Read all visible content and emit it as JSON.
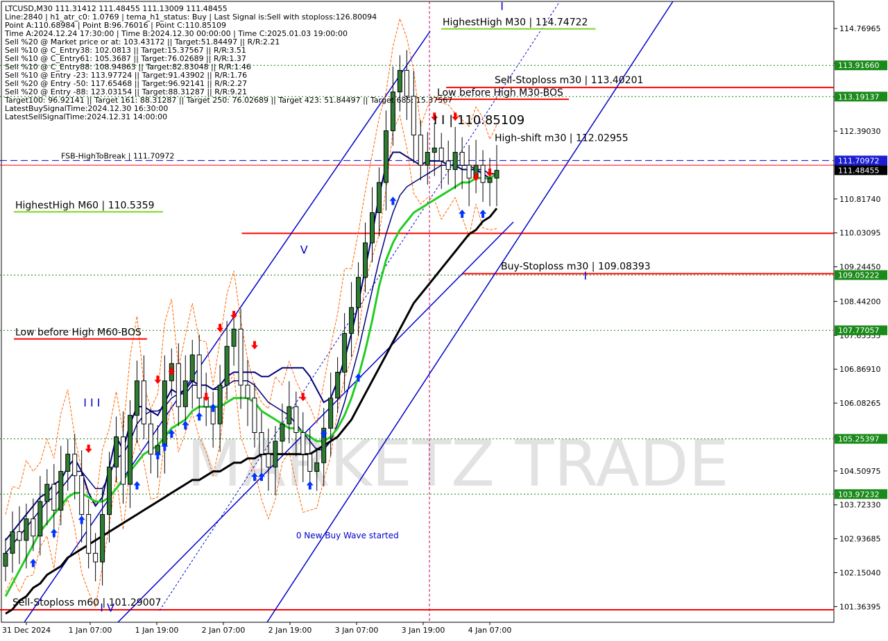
{
  "info_panel": {
    "lines": [
      "LTCUSD,M30  111.31412 111.48455 111.13009 111.48455",
      "Line:2840  | h1_atr_c0: 1.0769  | tema_h1_status: Buy  | Last Signal is:Sell with stoploss:126.80094",
      "Point A:110.68984  | Point B:96.76016  | Point C:110.85109",
      "Time A:2024.12.24 17:30:00  | Time B:2024.12.30 00:00:00  | Time C:2025.01.03 19:00:00",
      "Sell %20 @ Market price or at: 103.43172  || Target:51.84497  || R/R:2.21",
      "Sell %10 @ C_Entry38: 102.0813  || Target:15.37567  || R/R:3.51",
      "Sell %10 @ C_Entry61: 105.3687  || Target:76.02689  || R/R:1.37",
      "Sell %10 @ C_Entry88: 108.94863  || Target:82.83048  || R/R:1.46",
      "Sell %10 @ Entry -23: 113.97724  || Target:91.43902  || R/R:1.76",
      "Sell %20 @ Entry -50: 117.65468  || Target:96.92141  || R/R:2.27",
      "Sell %20 @ Entry -88: 123.03154  || Target:88.31287  || R/R:9.21",
      "Target100: 96.92141  || Target 161: 88.31287  || Target 250: 76.02689  || Target 423: 51.84497  || Target 685: 15.37567",
      "LatestBuySignalTime:2024.12.30 16:30:00",
      "LatestSellSignalTime:2024.12.31 14:00:00"
    ]
  },
  "watermark": {
    "text": "MARKETZ TRADE"
  },
  "colors": {
    "up_candle": "#000000",
    "down_candle": "#000000",
    "up_fill": "#2e7d32",
    "down_fill": "#ffffff",
    "red_line": "#ff0000",
    "green_dotted": "#1b7f1b",
    "blue_channel": "#0000cc",
    "navy_ma": "#00007a",
    "green_ma": "#22cc22",
    "black_ma": "#000000",
    "orange_band": "#ff6600",
    "buy_arrow": "#0033ff",
    "sell_arrow": "#ff0000",
    "label_green_bg": "#1a8a1a",
    "label_blue_bg": "#1c1cd4",
    "label_black_bg": "#000000"
  },
  "chart_data": {
    "type": "candlestick",
    "symbol": "LTCUSD",
    "timeframe": "M30",
    "ylim": [
      101.0,
      115.4
    ],
    "x_ticks": [
      "31 Dec 2024",
      "1 Jan 07:00",
      "1 Jan 19:00",
      "2 Jan 07:00",
      "2 Jan 19:00",
      "3 Jan 07:00",
      "3 Jan 19:00",
      "4 Jan 07:00"
    ],
    "y_ticks": [
      101.36395,
      102.1504,
      102.93685,
      103.7233,
      104.50975,
      105.2962,
      106.08265,
      106.8691,
      107.65555,
      108.442,
      109.2445,
      110.03095,
      110.8174,
      111.60385,
      112.3903,
      113.17675,
      113.9632,
      114.76965
    ],
    "price_tags": [
      {
        "text": "113.91660",
        "value": 113.9166,
        "style": "green"
      },
      {
        "text": "113.19137",
        "value": 113.19137,
        "style": "green"
      },
      {
        "text": "111.70972",
        "value": 111.70972,
        "style": "blue"
      },
      {
        "text": "111.48455",
        "value": 111.48455,
        "style": "black"
      },
      {
        "text": "109.05222",
        "value": 109.05222,
        "style": "green"
      },
      {
        "text": "107.77057",
        "value": 107.77057,
        "style": "green"
      },
      {
        "text": "105.25397",
        "value": 105.25397,
        "style": "green"
      },
      {
        "text": "103.97232",
        "value": 103.97232,
        "style": "green"
      }
    ],
    "horizontal_lines": [
      {
        "value": 113.40201,
        "style": "red",
        "x_start": 0.535
      },
      {
        "value": 110.02,
        "style": "red",
        "x_start": 0.29
      },
      {
        "value": 109.08393,
        "style": "red",
        "x_start": 0.555
      },
      {
        "value": 101.29007,
        "style": "red",
        "x_start": 0.0
      },
      {
        "value": 111.70972,
        "style": "blue-dash",
        "x_start": 0.0
      },
      {
        "value": 111.6,
        "style": "red-thin",
        "x_start": 0.0
      },
      {
        "value": 113.9166,
        "style": "green-dot",
        "x_start": 0.0
      },
      {
        "value": 113.19137,
        "style": "green-dot",
        "x_start": 0.0
      },
      {
        "value": 109.05222,
        "style": "green-dot",
        "x_start": 0.0
      },
      {
        "value": 107.77057,
        "style": "green-dot",
        "x_start": 0.0
      },
      {
        "value": 105.25397,
        "style": "green-dot",
        "x_start": 0.0
      },
      {
        "value": 103.97232,
        "style": "green-dot",
        "x_start": 0.0
      }
    ],
    "level_labels": [
      {
        "text": "HighestHigh   M30 | 114.74722",
        "value": 114.74722,
        "underline": "green"
      },
      {
        "text": "Sell-Stoploss m30 | 113.40201",
        "value": 113.40201,
        "underline": "none"
      },
      {
        "text": "Low before High   M30-BOS",
        "value": 113.40201,
        "underline": "red"
      },
      {
        "text": "High-shift m30 | 112.02955",
        "value": 112.02955,
        "underline": "none"
      },
      {
        "text": "FSB-HighToBreak | 111.70972",
        "value": 111.70972,
        "underline": "none"
      },
      {
        "text": "HighestHigh   M60 | 110.5359",
        "value": 110.5359,
        "underline": "green"
      },
      {
        "text": "Buy-Stoploss m30 | 109.08393",
        "value": 109.08393,
        "underline": "none"
      },
      {
        "text": "Low before High   M60-BOS",
        "value": 107.65,
        "underline": "red"
      },
      {
        "text": "Sell-Stoploss m60 | 101.29007",
        "value": 101.29007,
        "underline": "none"
      }
    ],
    "wave_labels": [
      {
        "text": "I",
        "x": 60,
        "value": 115.2
      },
      {
        "text": "I I | 110.85109",
        "x": 52,
        "value": 112.55
      },
      {
        "text": "V",
        "x": 36,
        "value": 109.55
      },
      {
        "text": "I I I",
        "x": 10,
        "value": 106.0
      },
      {
        "text": "I V",
        "x": 12,
        "value": 101.25
      },
      {
        "text": "I",
        "x": 70,
        "value": 108.95
      }
    ],
    "annotations": [
      {
        "text": "0 New Buy Wave started",
        "x": 43,
        "value": 102.95
      }
    ],
    "candles": {
      "count": 72,
      "close": [
        102.6,
        103.1,
        102.9,
        103.4,
        103.0,
        103.8,
        104.2,
        103.6,
        104.5,
        104.9,
        104.4,
        103.5,
        102.6,
        102.4,
        103.5,
        104.6,
        105.3,
        104.2,
        105.8,
        106.6,
        105.6,
        104.9,
        105.1,
        106.6,
        107.0,
        106.0,
        106.6,
        107.2,
        106.2,
        106.0,
        105.6,
        106.5,
        107.4,
        107.8,
        106.5,
        106.2,
        105.4,
        104.9,
        104.6,
        105.2,
        105.6,
        106.0,
        105.4,
        104.9,
        104.5,
        104.7,
        105.5,
        106.2,
        106.8,
        107.7,
        108.3,
        109.0,
        109.8,
        110.5,
        111.2,
        112.4,
        113.3,
        113.8,
        113.2,
        112.3,
        111.6,
        111.9,
        112.0,
        111.7,
        111.5,
        111.9,
        111.6,
        111.3,
        111.6,
        111.2,
        111.3,
        111.48
      ]
    },
    "series": [
      {
        "name": "",
        "key": "navy_fast",
        "style": "navy",
        "values": [
          102.9,
          103.1,
          103.3,
          103.5,
          103.7,
          103.9,
          104.0,
          104.2,
          104.3,
          104.6,
          104.8,
          104.5,
          104.0,
          103.7,
          103.9,
          104.6,
          105.3,
          105.0,
          105.6,
          106.0,
          106.0,
          105.9,
          105.8,
          106.1,
          106.4,
          106.3,
          106.4,
          106.6,
          106.5,
          106.5,
          106.4,
          106.5,
          106.7,
          106.8,
          106.8,
          106.8,
          106.8,
          106.7,
          106.7,
          106.8,
          106.9,
          106.9,
          106.9,
          106.9,
          106.7,
          106.4,
          106.1,
          106.2,
          106.6,
          107.1,
          107.7,
          108.4,
          109.2,
          110.0,
          110.9,
          111.6,
          111.9,
          111.9,
          111.8,
          111.7,
          111.6,
          111.7,
          111.7,
          111.7,
          111.6,
          111.6,
          111.5,
          111.5,
          111.5,
          111.4,
          111.3,
          111.4
        ]
      },
      {
        "name": "",
        "key": "navy_slow",
        "style": "navy-thin",
        "values": [
          102.6,
          102.8,
          103.0,
          103.2,
          103.4,
          103.6,
          103.8,
          103.9,
          104.1,
          104.3,
          104.5,
          104.5,
          104.3,
          104.1,
          104.1,
          104.4,
          104.8,
          104.9,
          105.2,
          105.6,
          105.8,
          105.9,
          105.9,
          106.0,
          106.2,
          106.3,
          106.3,
          106.5,
          106.5,
          106.5,
          106.4,
          106.4,
          106.5,
          106.6,
          106.6,
          106.6,
          106.5,
          106.3,
          106.1,
          106.0,
          105.9,
          105.8,
          105.6,
          105.4,
          105.2,
          105.0,
          105.0,
          105.2,
          105.6,
          106.1,
          106.7,
          107.3,
          108.0,
          108.7,
          109.4,
          110.0,
          110.5,
          110.9,
          111.1,
          111.2,
          111.3,
          111.4,
          111.5,
          111.6,
          111.6,
          111.6,
          111.6,
          111.6,
          111.5,
          111.5,
          111.4,
          111.4
        ]
      },
      {
        "name": "",
        "key": "green_ma",
        "style": "green",
        "values": [
          101.6,
          101.9,
          102.2,
          102.5,
          102.8,
          103.1,
          103.3,
          103.5,
          103.7,
          103.9,
          104.0,
          104.0,
          103.9,
          103.8,
          103.8,
          103.9,
          104.1,
          104.3,
          104.5,
          104.7,
          104.9,
          105.0,
          105.1,
          105.3,
          105.5,
          105.6,
          105.7,
          105.9,
          106.0,
          106.0,
          106.0,
          106.0,
          106.1,
          106.2,
          106.2,
          106.2,
          106.1,
          105.9,
          105.8,
          105.7,
          105.6,
          105.5,
          105.5,
          105.4,
          105.3,
          105.2,
          105.2,
          105.3,
          105.5,
          105.8,
          106.2,
          106.7,
          107.3,
          108.0,
          108.8,
          109.4,
          109.8,
          110.1,
          110.3,
          110.5,
          110.6,
          110.7,
          110.8,
          110.9,
          111.0,
          111.1,
          111.2,
          111.2,
          111.3,
          111.3,
          111.3,
          111.4
        ]
      },
      {
        "name": "",
        "key": "black_ma",
        "style": "black",
        "values": [
          101.2,
          101.3,
          101.5,
          101.6,
          101.8,
          101.9,
          102.1,
          102.2,
          102.3,
          102.5,
          102.6,
          102.7,
          102.8,
          102.9,
          103.0,
          103.1,
          103.2,
          103.3,
          103.4,
          103.5,
          103.6,
          103.7,
          103.8,
          103.9,
          104.0,
          104.1,
          104.2,
          104.3,
          104.3,
          104.4,
          104.5,
          104.5,
          104.6,
          104.7,
          104.7,
          104.8,
          104.8,
          104.9,
          104.9,
          104.9,
          104.9,
          104.9,
          104.9,
          104.9,
          104.9,
          105.0,
          105.1,
          105.2,
          105.3,
          105.5,
          105.7,
          106.0,
          106.3,
          106.6,
          106.9,
          107.2,
          107.5,
          107.8,
          108.1,
          108.4,
          108.6,
          108.8,
          109.0,
          109.2,
          109.4,
          109.6,
          109.8,
          110.0,
          110.1,
          110.3,
          110.4,
          110.6
        ]
      }
    ],
    "buy_signals": [
      {
        "i": 4,
        "v": 102.6
      },
      {
        "i": 7,
        "v": 103.3
      },
      {
        "i": 11,
        "v": 103.6
      },
      {
        "i": 19,
        "v": 104.4
      },
      {
        "i": 22,
        "v": 105.1
      },
      {
        "i": 23,
        "v": 105.3
      },
      {
        "i": 24,
        "v": 105.6
      },
      {
        "i": 26,
        "v": 105.8
      },
      {
        "i": 28,
        "v": 106.0
      },
      {
        "i": 30,
        "v": 106.2
      },
      {
        "i": 36,
        "v": 104.6
      },
      {
        "i": 37,
        "v": 104.6
      },
      {
        "i": 44,
        "v": 104.4
      },
      {
        "i": 46,
        "v": 105.6
      },
      {
        "i": 51,
        "v": 106.9
      },
      {
        "i": 56,
        "v": 111.0
      },
      {
        "i": 66,
        "v": 110.7
      },
      {
        "i": 69,
        "v": 110.7
      }
    ],
    "sell_signals": [
      {
        "i": 12,
        "v": 104.8
      },
      {
        "i": 22,
        "v": 106.4
      },
      {
        "i": 24,
        "v": 106.6
      },
      {
        "i": 29,
        "v": 106.0
      },
      {
        "i": 31,
        "v": 107.6
      },
      {
        "i": 33,
        "v": 107.9
      },
      {
        "i": 36,
        "v": 107.2
      },
      {
        "i": 43,
        "v": 106.0
      },
      {
        "i": 62,
        "v": 112.5
      },
      {
        "i": 65,
        "v": 112.5
      },
      {
        "i": 68,
        "v": 111.1
      },
      {
        "i": 70,
        "v": 111.2
      }
    ]
  }
}
